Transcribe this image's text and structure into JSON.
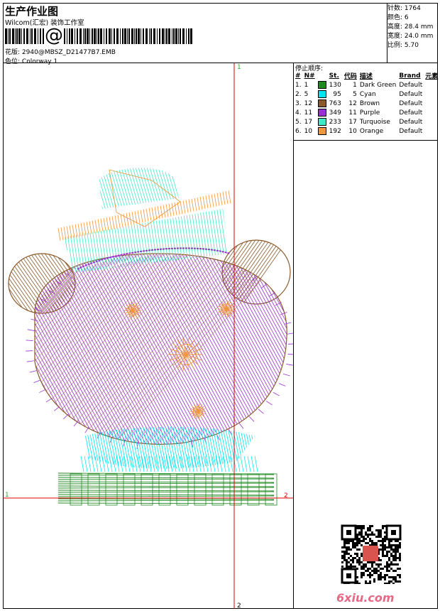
{
  "header": {
    "title": "生产作业图",
    "company": "Wilcom(汇宏) 装饰工作室",
    "barcode_symbol": "@",
    "design_label": "花版:",
    "design_value": "2940@MBSZ_D21477B7.EMB",
    "colorway_label": "色位:",
    "colorway_value": "Colorway 1"
  },
  "stats": {
    "stitches_label": "针数:",
    "stitches_value": "1764",
    "colors_label": "颜色:",
    "colors_value": "6",
    "height_label": "高度:",
    "height_value": "28.4 mm",
    "width_label": "宽度:",
    "width_value": "24.0 mm",
    "ratio_label": "比例:",
    "ratio_value": "5.70"
  },
  "color_table": {
    "title": "停止顺序:",
    "headers": {
      "order": "#",
      "needle": "N#",
      "stitches": "St.",
      "code": "代码",
      "desc": "描述",
      "brand": "Brand",
      "element": "元素"
    },
    "rows": [
      {
        "order": "1.",
        "needle": "1",
        "color": "#1f8a1f",
        "stitches": "130",
        "code": "1",
        "desc": "Dark Green",
        "brand": "Default"
      },
      {
        "order": "2.",
        "needle": "5",
        "color": "#00e5ee",
        "stitches": "95",
        "code": "5",
        "desc": "Cyan",
        "brand": "Default"
      },
      {
        "order": "3.",
        "needle": "12",
        "color": "#8b5a2b",
        "stitches": "763",
        "code": "12",
        "desc": "Brown",
        "brand": "Default"
      },
      {
        "order": "4.",
        "needle": "11",
        "color": "#9b30d0",
        "stitches": "349",
        "code": "11",
        "desc": "Purple",
        "brand": "Default"
      },
      {
        "order": "5.",
        "needle": "17",
        "color": "#40e8c8",
        "stitches": "233",
        "code": "17",
        "desc": "Turquoise",
        "brand": "Default"
      },
      {
        "order": "6.",
        "needle": "10",
        "color": "#f0963c",
        "stitches": "192",
        "code": "10",
        "desc": "Orange",
        "brand": "Default"
      }
    ]
  },
  "axis_marks": {
    "top": "1",
    "bottom": "2",
    "left": "1",
    "right": "2"
  },
  "footer": {
    "site": "6xiu.com"
  }
}
